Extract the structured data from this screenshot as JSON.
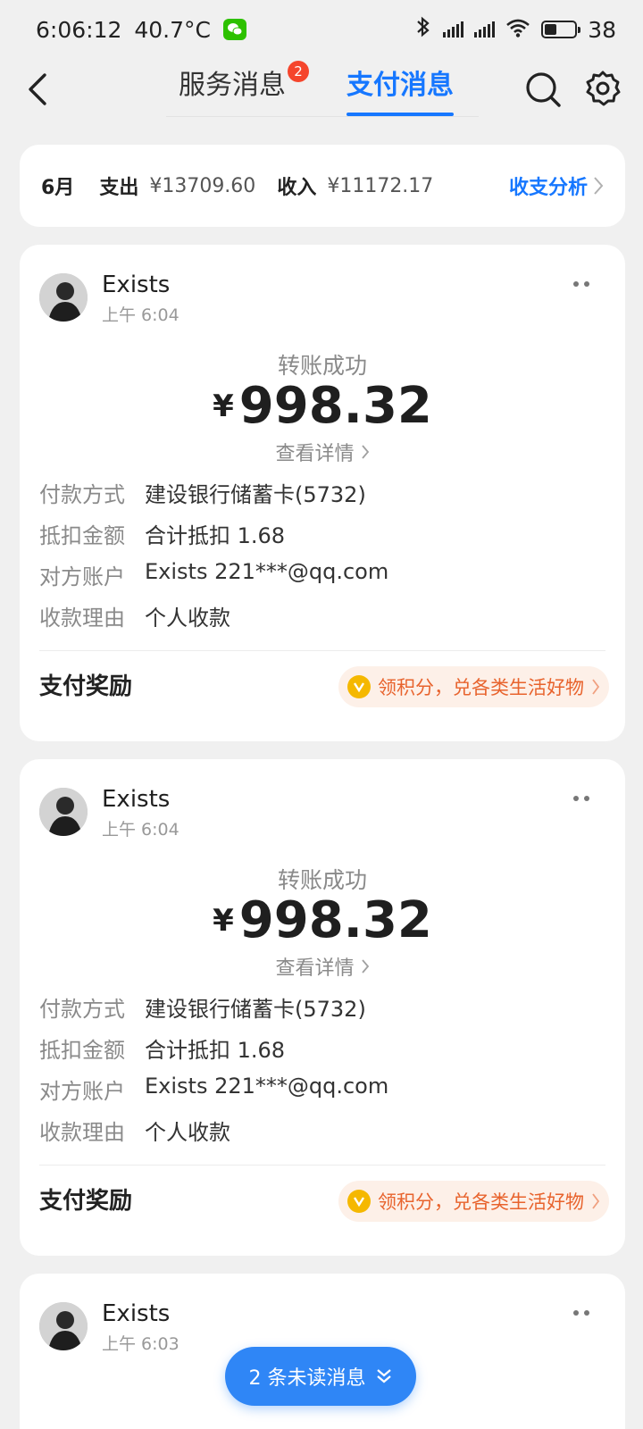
{
  "status_bar": {
    "time": "6:06:12",
    "temperature": "40.7°C",
    "battery_level": "38"
  },
  "nav": {
    "tab_service": "服务消息",
    "tab_service_badge": "2",
    "tab_pay": "支付消息"
  },
  "summary": {
    "month": "6月",
    "expense_label": "支出",
    "expense_value": "¥13709.60",
    "income_label": "收入",
    "income_value": "¥11172.17",
    "analysis_label": "收支分析"
  },
  "messages": [
    {
      "sender": "Exists",
      "time": "上午 6:04",
      "status": "转账成功",
      "currency": "¥",
      "amount": "998.32",
      "detail_link": "查看详情",
      "rows": [
        {
          "key": "付款方式",
          "value": "建设银行储蓄卡(5732)"
        },
        {
          "key": "抵扣金额",
          "value": "合计抵扣 1.68"
        },
        {
          "key": "对方账户",
          "value": "Exists 221***@qq.com"
        },
        {
          "key": "收款理由",
          "value": "个人收款"
        }
      ],
      "reward_label": "支付奖励",
      "reward_text": "领积分，兑各类生活好物"
    },
    {
      "sender": "Exists",
      "time": "上午 6:04",
      "status": "转账成功",
      "currency": "¥",
      "amount": "998.32",
      "detail_link": "查看详情",
      "rows": [
        {
          "key": "付款方式",
          "value": "建设银行储蓄卡(5732)"
        },
        {
          "key": "抵扣金额",
          "value": "合计抵扣 1.68"
        },
        {
          "key": "对方账户",
          "value": "Exists 221***@qq.com"
        },
        {
          "key": "收款理由",
          "value": "个人收款"
        }
      ],
      "reward_label": "支付奖励",
      "reward_text": "领积分，兑各类生活好物"
    },
    {
      "sender": "Exists",
      "time": "上午 6:03"
    }
  ],
  "unread_button": "2 条未读消息",
  "colors": {
    "accent": "#1677ff",
    "reward": "#e8632d",
    "badge": "#f5452c",
    "unread_button": "#2f86f6"
  }
}
